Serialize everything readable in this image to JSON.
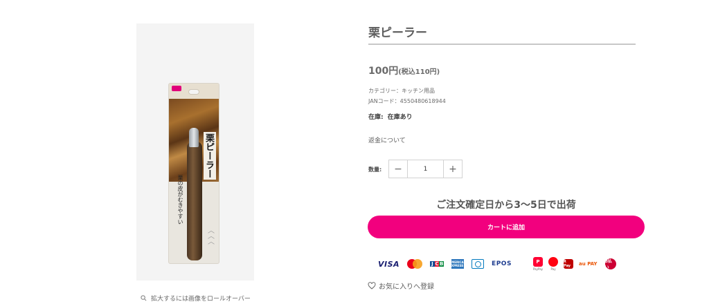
{
  "product": {
    "title": "栗ピーラー",
    "price_main": "100円",
    "price_tax": "(税込110円)",
    "category": "カテゴリー：キッチン用品",
    "jan": "JANコード：4550480618944",
    "stock_label": "在庫:",
    "stock_value": "在庫あり",
    "refund_link": "返金について",
    "quantity_label": "数量:",
    "quantity_value": "1",
    "minus": "−",
    "plus": "+",
    "shipping_note": "ご注文確定日から3〜5日で出荷",
    "cart_button": "カートに追加",
    "favorite_link": "お気に入りへ登録",
    "zoom_hint": "拡大するには画像をロールオーバー"
  },
  "package_art": {
    "title": "栗ピーラー",
    "subtitle": "栗の皮がむきやすい"
  },
  "payments": {
    "visa": "VISA",
    "jcb_letters": [
      "J",
      "C",
      "B"
    ],
    "amex": "AMERICAN EXPRESS",
    "epos": "EPOS",
    "paypay_label": "PayPay",
    "merpay_label": "Pay",
    "rpay": "R Pay",
    "aupay": "au PAY",
    "dbarai": "d払い"
  },
  "colors": {
    "accent": "#f2007e",
    "title": "#5f5f5f"
  }
}
